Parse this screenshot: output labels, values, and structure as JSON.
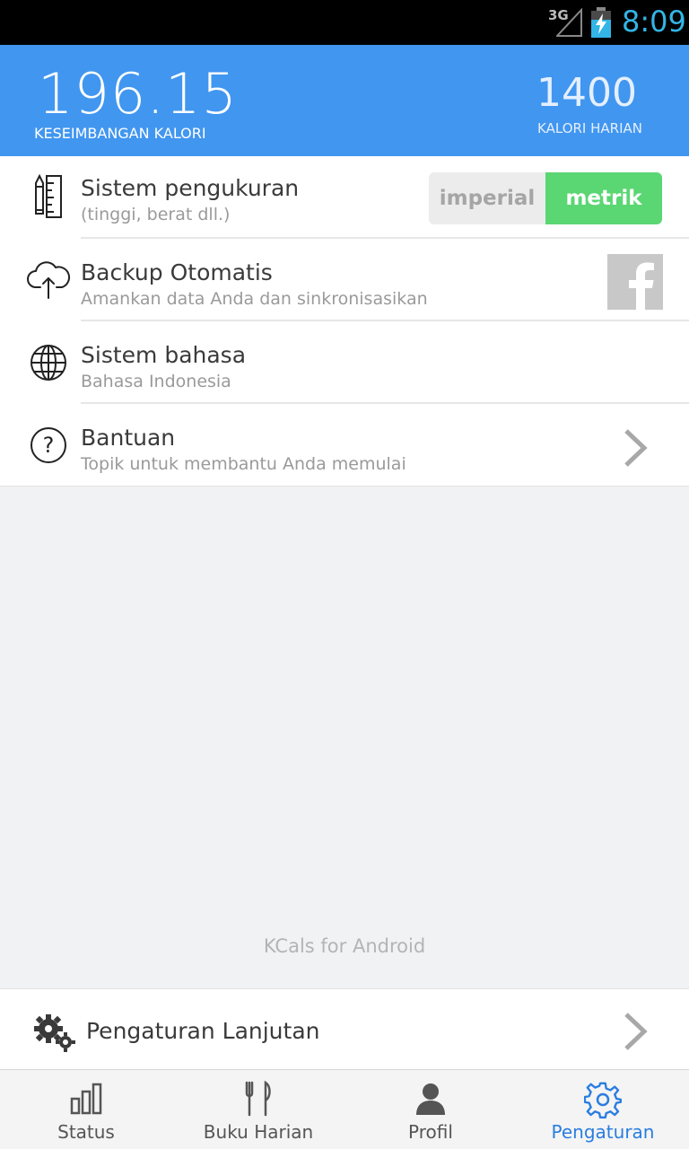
{
  "status_bar": {
    "network": "3G",
    "time": "8:09"
  },
  "header": {
    "balance_value": "196.15",
    "balance_label": "KESEIMBANGAN KALORI",
    "daily_value": "1400",
    "daily_label": "KALORI HARIAN"
  },
  "settings": [
    {
      "title": "Sistem pengukuran",
      "subtitle": "(tinggi, berat dll.)",
      "icon": "ruler-pencil-icon",
      "toggle": {
        "options": [
          "imperial",
          "metrik"
        ],
        "selected": "metrik"
      }
    },
    {
      "title": "Backup Otomatis",
      "subtitle": "Amankan data Anda dan sinkronisasikan",
      "icon": "cloud-upload-icon",
      "action_icon": "facebook-icon"
    },
    {
      "title": "Sistem bahasa",
      "subtitle": "Bahasa Indonesia",
      "icon": "globe-icon"
    },
    {
      "title": "Bantuan",
      "subtitle": "Topik untuk membantu Anda memulai",
      "icon": "help-circle-icon",
      "action_icon": "chevron-right-icon"
    }
  ],
  "footer_text": "KCals for Android",
  "advanced": {
    "label": "Pengaturan Lanjutan",
    "icon": "gears-icon"
  },
  "nav": [
    {
      "label": "Status",
      "icon": "bar-chart-icon",
      "active": false
    },
    {
      "label": "Buku Harian",
      "icon": "fork-knife-icon",
      "active": false
    },
    {
      "label": "Profil",
      "icon": "person-icon",
      "active": false
    },
    {
      "label": "Pengaturan",
      "icon": "gear-icon",
      "active": true
    }
  ],
  "colors": {
    "header_bg": "#4196f0",
    "toggle_on": "#5ad673",
    "nav_active": "#2a7de1",
    "status_time": "#33b5e5"
  }
}
